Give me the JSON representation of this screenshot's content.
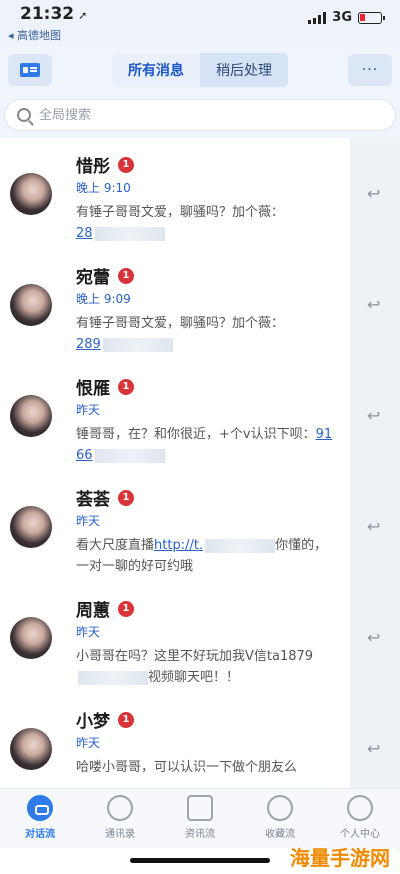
{
  "status_bar": {
    "time": "21:32",
    "back_app": "◂ 高德地图",
    "network": "3G"
  },
  "nav": {
    "tabs": [
      {
        "label": "所有消息",
        "active": true
      },
      {
        "label": "稍后处理",
        "active": false
      }
    ],
    "more": "···"
  },
  "search": {
    "placeholder": "全局搜索"
  },
  "messages": [
    {
      "name": "惜彤",
      "badge": "1",
      "time": "晚上 9:10",
      "text": "有锤子哥哥文爱，聊骚吗？加个薇：",
      "link": "28"
    },
    {
      "name": "宛蕾",
      "badge": "1",
      "time": "晚上 9:09",
      "text": "有锤子哥哥文爱，聊骚吗？加个薇：",
      "link": "289"
    },
    {
      "name": "恨雁",
      "badge": "1",
      "time": "昨天",
      "text": "锤哥哥，在？和你很近，+个v认识下呗：",
      "link": "9166"
    },
    {
      "name": "荟荟",
      "badge": "1",
      "time": "昨天",
      "text": "看大尺度直播",
      "link": "http://t.",
      "text2": "你懂的，一对一聊的好可约哦"
    },
    {
      "name": "周蕙",
      "badge": "1",
      "time": "昨天",
      "text": "小哥哥在吗？这里不好玩加我V信ta1879",
      "text2": "视频聊天吧！！"
    },
    {
      "name": "小梦",
      "badge": "1",
      "time": "昨天",
      "text": "哈喽小哥哥，可以认识一下做个朋友么"
    }
  ],
  "tabbar": [
    {
      "label": "对话流",
      "icon": "chat-bubble-icon",
      "active": true
    },
    {
      "label": "通讯录",
      "icon": "contacts-icon",
      "active": false
    },
    {
      "label": "资讯流",
      "icon": "news-icon",
      "active": false
    },
    {
      "label": "收藏流",
      "icon": "favorites-icon",
      "active": false
    },
    {
      "label": "个人中心",
      "icon": "profile-icon",
      "active": false
    }
  ],
  "watermark": "海量手游网",
  "colors": {
    "accent": "#2f7bea",
    "badge": "#d9343a",
    "time": "#2a62c8"
  }
}
